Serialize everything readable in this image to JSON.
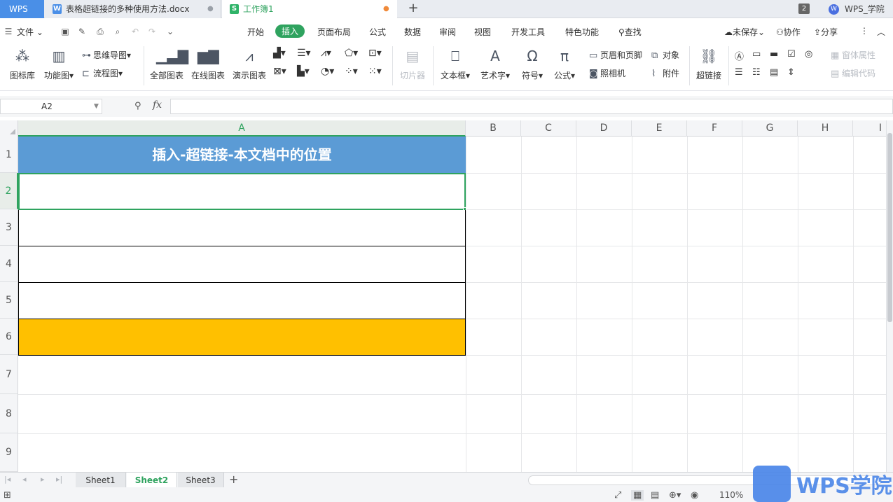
{
  "titlebar": {
    "app_tab": "WPS",
    "tabs": [
      {
        "label": "表格超链接的多种使用方法.docx",
        "icon": "W",
        "close": "●"
      },
      {
        "label": "工作簿1",
        "icon": "S",
        "close": "●"
      }
    ],
    "new_tab": "+",
    "badge_count": "2",
    "user_avatar": "W",
    "user_name": "WPS_学院"
  },
  "menubar": {
    "file": "文件",
    "items": [
      "开始",
      "插入",
      "页面布局",
      "公式",
      "数据",
      "审阅",
      "视图",
      "开发工具",
      "特色功能",
      "查找"
    ],
    "right": {
      "unsaved": "未保存",
      "collaborate": "协作",
      "share": "分享"
    }
  },
  "ribbon": {
    "icon_lib": "图标库",
    "func_chart": "功能图",
    "mindmap": "思维导图",
    "flowchart": "流程图",
    "all_charts": "全部图表",
    "online_charts": "在线图表",
    "demo_charts": "演示图表",
    "slicer": "切片器",
    "textbox": "文本框",
    "wordart": "艺术字",
    "symbol": "符号",
    "formula": "公式",
    "header_footer": "页眉和页脚",
    "object": "对象",
    "camera": "照相机",
    "attachment": "附件",
    "hyperlink": "超链接",
    "window_props": "窗体属性",
    "edit_code": "编辑代码"
  },
  "formulabar": {
    "cell_ref": "A2",
    "fx": "fx",
    "value": ""
  },
  "grid": {
    "columns": [
      "A",
      "B",
      "C",
      "D",
      "E",
      "F",
      "G",
      "H",
      "I"
    ],
    "rows": [
      "1",
      "2",
      "3",
      "4",
      "5",
      "6",
      "7",
      "8",
      "9"
    ],
    "cells": {
      "A1": "插入-超链接-本文档中的位置",
      "A2": "",
      "A3": "",
      "A4": "",
      "A5": "",
      "A6": ""
    },
    "colors": {
      "header_fill": "#5b9bd5",
      "highlight_fill": "#ffc000",
      "selection": "#2fa35f"
    }
  },
  "sheets": [
    "Sheet1",
    "Sheet2",
    "Sheet3"
  ],
  "statusbar": {
    "zoom": "110%"
  },
  "watermark": {
    "text": "WPS学院"
  }
}
